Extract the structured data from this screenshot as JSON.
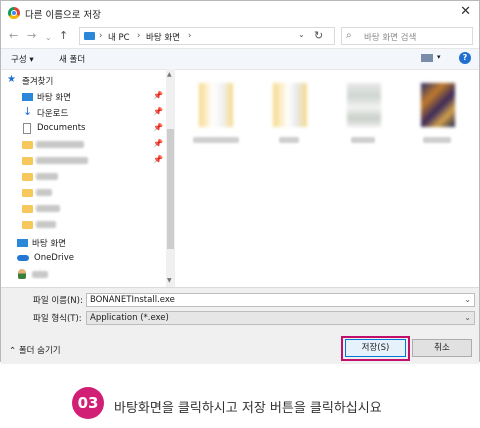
{
  "dialog": {
    "title": "다른 이름으로 저장",
    "close": "✕"
  },
  "address": {
    "back": "←",
    "forward": "→",
    "up": "↑",
    "down_chevron": "⌄",
    "crumbs": [
      "내 PC",
      "바탕 화면"
    ],
    "sep": "›",
    "dropdown": "⌄",
    "refresh": "↻",
    "search_placeholder": "바탕 화면 검색"
  },
  "toolbar": {
    "organize": "구성 ▾",
    "new_folder": "새 폴더",
    "view_dd": "▾",
    "help": "?"
  },
  "nav": {
    "quick_access": "즐겨찾기",
    "desktop": "바탕 화면",
    "downloads": "다운로드",
    "documents": "Documents",
    "this_pc_desktop": "바탕 화면",
    "onedrive": "OneDrive"
  },
  "form": {
    "filename_label": "파일 이름(N):",
    "filename_value": "BONANETInstall.exe",
    "filetype_label": "파일 형식(T):",
    "filetype_value": "Application (*.exe)",
    "dd": "⌄"
  },
  "footer": {
    "hide_folders": "⌃ 폴더 숨기기",
    "save": "저장(S)",
    "cancel": "취소"
  },
  "instruction": {
    "step": "03",
    "text": "바탕화면을 클릭하시고 저장 버튼을 클릭하십시요"
  },
  "colors": {
    "accent": "#d21f76",
    "highlight_border": "#c0106a",
    "folder": "#f6c85b",
    "windows_blue": "#0078d7"
  }
}
